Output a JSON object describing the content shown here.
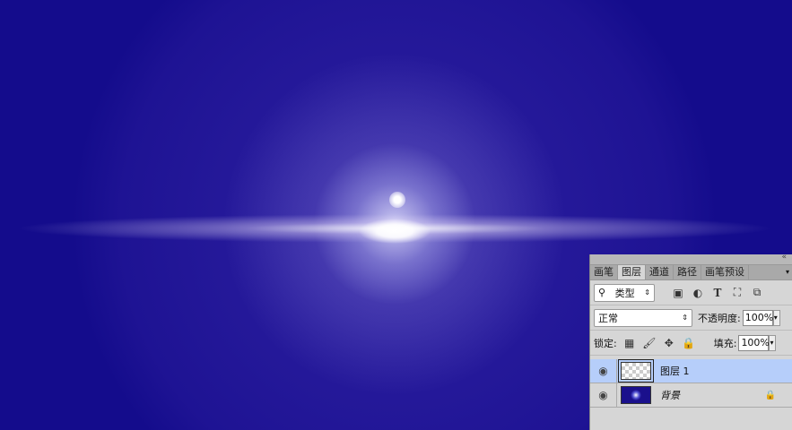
{
  "panel": {
    "collapse_icon": "«",
    "tabs": [
      {
        "label": "画笔"
      },
      {
        "label": "图层"
      },
      {
        "label": "通道"
      },
      {
        "label": "路径"
      },
      {
        "label": "画笔预设"
      }
    ],
    "tab_menu_icon": "▾",
    "filter": {
      "label": "类型",
      "icon": "search-icon"
    },
    "blend_mode": "正常",
    "opacity_label": "不透明度:",
    "opacity": "100%",
    "lock_label": "锁定:",
    "fill_label": "填充:",
    "fill": "100%",
    "layers": [
      {
        "name": "图层 1",
        "selected": true
      },
      {
        "name": "背景",
        "locked": true
      }
    ]
  }
}
